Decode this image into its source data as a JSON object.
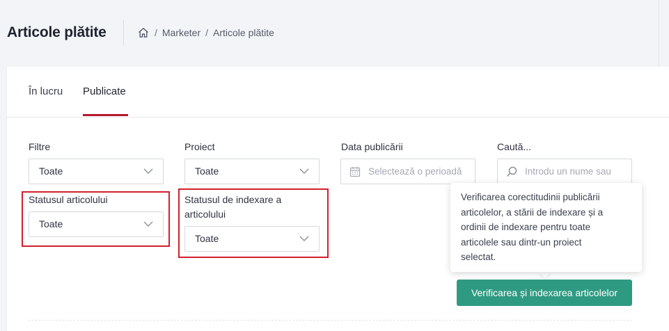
{
  "header": {
    "title": "Articole plătite",
    "breadcrumb": [
      "Marketer",
      "Articole plătite"
    ],
    "home_icon": "home-icon"
  },
  "tabs": [
    {
      "label": "În lucru",
      "active": false
    },
    {
      "label": "Publicate",
      "active": true
    }
  ],
  "filters": {
    "filtre": {
      "label": "Filtre",
      "value": "Toate"
    },
    "proiect": {
      "label": "Proiect",
      "value": "Toate"
    },
    "data": {
      "label": "Data publicării",
      "placeholder": "Selectează o perioadă",
      "icon": "calendar-icon"
    },
    "cauta": {
      "label": "Caută...",
      "placeholder": "Introdu un nume sau",
      "icon": "search-icon"
    },
    "statusul_articolului": {
      "label": "Statusul articolului",
      "value": "Toate"
    },
    "statusul_indexare": {
      "label_line1": "Statusul de indexare a",
      "label_line2": "articolului",
      "value": "Toate"
    }
  },
  "tooltip": {
    "lines": [
      "Verificarea corectitudinii publicării",
      "articolelor, a stării de indexare și a",
      "ordinii de indexare pentru toate",
      "articolele sau dintr-un proiect",
      "selectat."
    ]
  },
  "verify_button": {
    "label": "Verificarea și indexarea articolelor"
  },
  "colors": {
    "accent": "#b5172f",
    "highlight_box": "#d11f2c",
    "button": "#2f9a82",
    "background": "#f3f4f7"
  }
}
